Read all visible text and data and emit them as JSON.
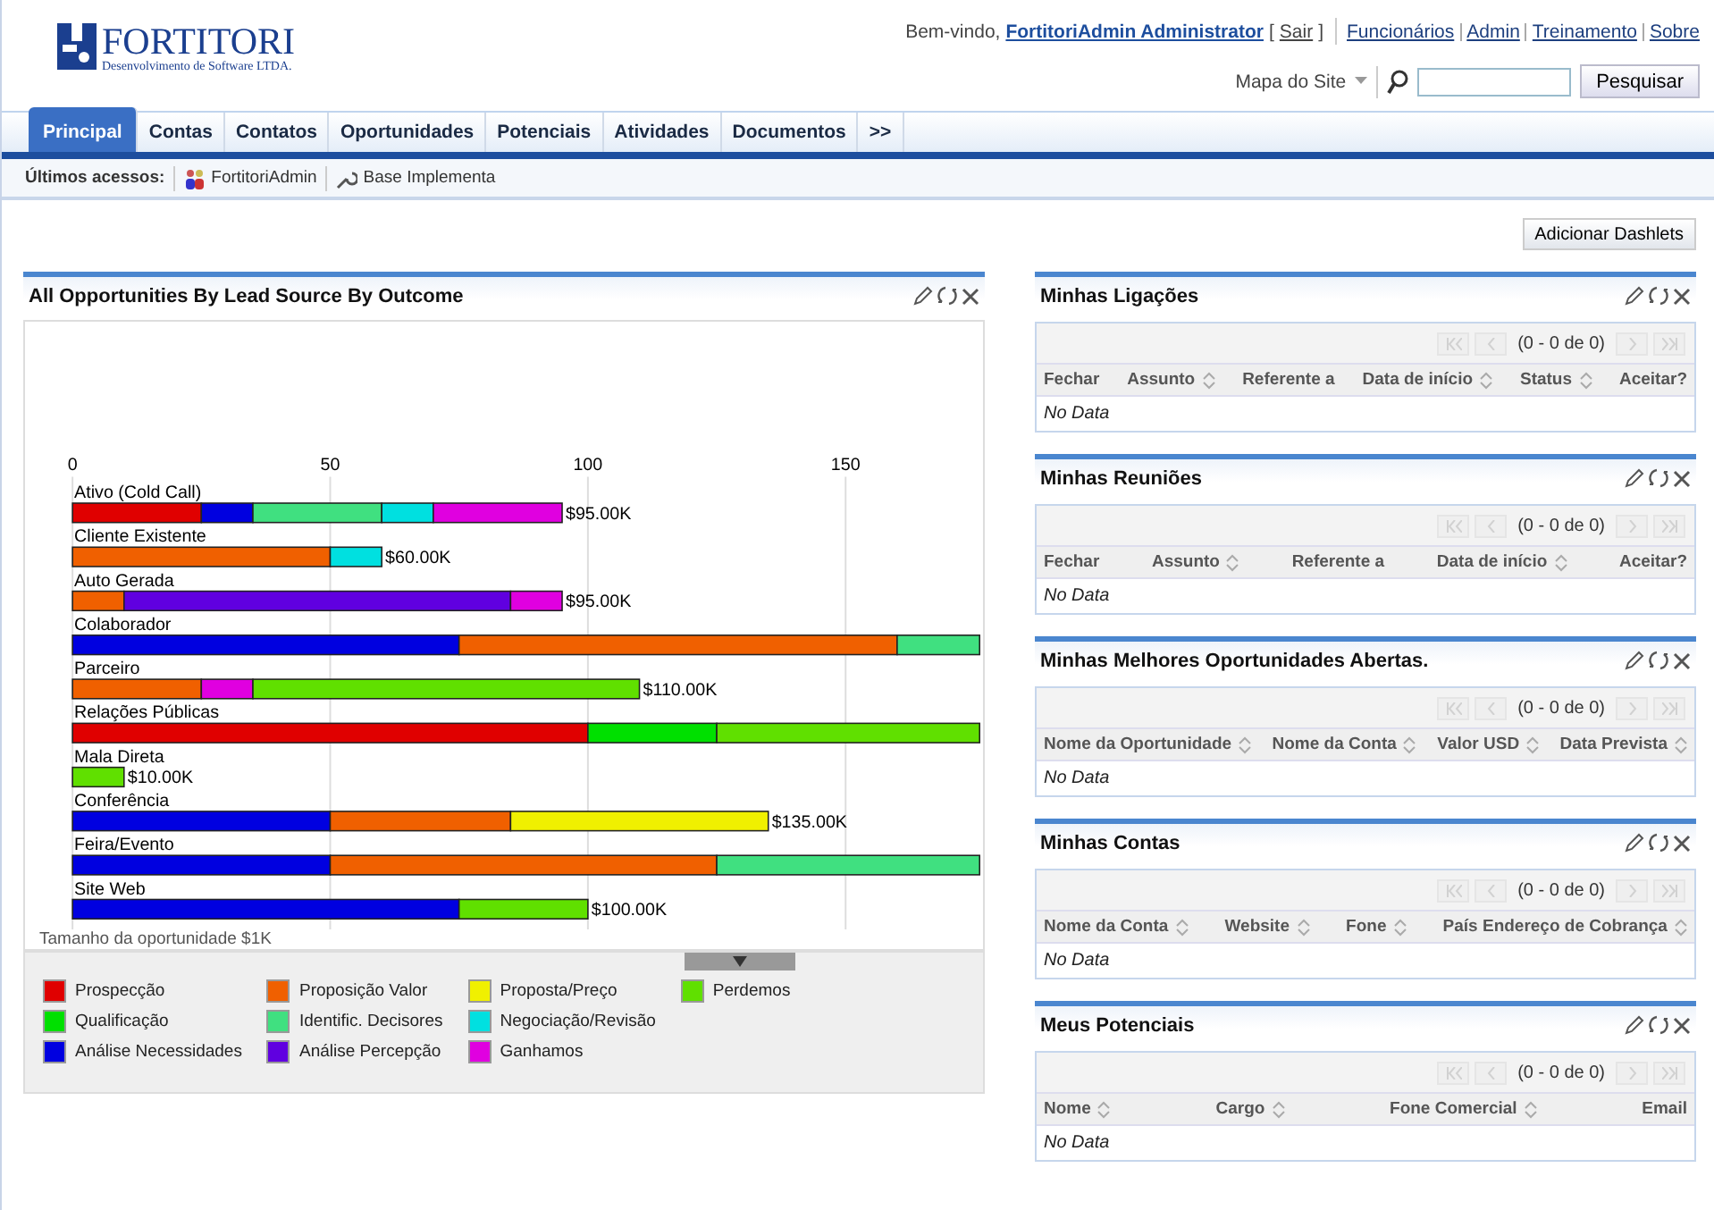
{
  "header": {
    "logo": {
      "name": "FORTITORI",
      "tagline": "Desenvolvimento de Software LTDA."
    },
    "welcome": {
      "greeting": "Bem-vindo,",
      "user": "FortitoriAdmin Administrator",
      "bracket_open": "[",
      "logout": "Sair",
      "bracket_close": "]"
    },
    "links": [
      "Funcionários",
      "Admin",
      "Treinamento",
      "Sobre"
    ],
    "sitemap": "Mapa do Site",
    "search_button": "Pesquisar"
  },
  "tabs": [
    {
      "label": "Principal",
      "selected": true
    },
    {
      "label": "Contas",
      "selected": false
    },
    {
      "label": "Contatos",
      "selected": false
    },
    {
      "label": "Oportunidades",
      "selected": false
    },
    {
      "label": "Potenciais",
      "selected": false
    },
    {
      "label": "Atividades",
      "selected": false
    },
    {
      "label": "Documentos",
      "selected": false
    },
    {
      "label": ">>",
      "selected": false
    }
  ],
  "recent": {
    "label": "Últimos acessos:",
    "items": [
      {
        "label": "FortitoriAdmin",
        "kind": "user"
      },
      {
        "label": "Base Implementa",
        "kind": "tool"
      }
    ]
  },
  "add_dashlets": "Adicionar Dashlets",
  "chart_panel": {
    "title": "All Opportunities By Lead Source By Outcome",
    "chart_data": {
      "type": "bar",
      "orientation": "horizontal",
      "stacked": true,
      "grid": true,
      "xlabel": "Tamanho da oportunidade $1K",
      "xlim": [
        0,
        176
      ],
      "xticks": [
        0,
        50,
        100,
        150
      ],
      "categories": [
        "Ativo (Cold Call)",
        "Cliente Existente",
        "Auto Gerada",
        "Colaborador",
        "Parceiro",
        "Relações Públicas",
        "Mala Direta",
        "Conferência",
        "Feira/Evento",
        "Site Web"
      ],
      "value_labels": [
        "$95.00K",
        "$60.00K",
        "$95.00K",
        null,
        "$110.00K",
        null,
        "$10.00K",
        "$135.00K",
        null,
        "$100.00K"
      ],
      "series": [
        {
          "name": "Prospecção",
          "color": "#e00000",
          "values": [
            25,
            0,
            0,
            0,
            0,
            100,
            0,
            0,
            0,
            0
          ]
        },
        {
          "name": "Qualificação",
          "color": "#00e000",
          "values": [
            0,
            0,
            0,
            0,
            0,
            25,
            0,
            0,
            0,
            0
          ]
        },
        {
          "name": "Análise Necessidades",
          "color": "#0000e0",
          "values": [
            10,
            0,
            0,
            75,
            0,
            0,
            0,
            50,
            50,
            75
          ]
        },
        {
          "name": "Proposição Valor",
          "color": "#f06000",
          "values": [
            0,
            50,
            10,
            85,
            25,
            0,
            0,
            35,
            75,
            0
          ]
        },
        {
          "name": "Identific. Decisores",
          "color": "#40e080",
          "values": [
            25,
            0,
            0,
            16,
            0,
            0,
            0,
            0,
            51,
            0
          ]
        },
        {
          "name": "Análise Percepção",
          "color": "#6000e0",
          "values": [
            0,
            0,
            75,
            0,
            0,
            0,
            0,
            0,
            0,
            0
          ]
        },
        {
          "name": "Proposta/Preço",
          "color": "#f0f000",
          "values": [
            0,
            0,
            0,
            0,
            0,
            0,
            0,
            50,
            0,
            0
          ]
        },
        {
          "name": "Negociação/Revisão",
          "color": "#00e0e0",
          "values": [
            10,
            10,
            0,
            0,
            0,
            0,
            0,
            0,
            0,
            0
          ]
        },
        {
          "name": "Ganhamos",
          "color": "#e000e0",
          "values": [
            25,
            0,
            10,
            0,
            10,
            0,
            0,
            0,
            0,
            0
          ]
        },
        {
          "name": "Perdemos",
          "color": "#60e000",
          "values": [
            0,
            0,
            0,
            0,
            75,
            51,
            10,
            0,
            0,
            25
          ]
        }
      ]
    }
  },
  "dashlets": [
    {
      "title": "Minhas Ligações",
      "pager": "(0 - 0 de 0)",
      "pager_disabled": true,
      "columns": [
        {
          "label": "Fechar",
          "sortable": false
        },
        {
          "label": "Assunto",
          "sortable": true
        },
        {
          "label": "Referente a",
          "sortable": false
        },
        {
          "label": "Data de início",
          "sortable": true
        },
        {
          "label": "Status",
          "sortable": true
        },
        {
          "label": "Aceitar?",
          "sortable": false
        }
      ],
      "empty_text": "No Data"
    },
    {
      "title": "Minhas Reuniões",
      "pager": "(0 - 0 de 0)",
      "pager_disabled": true,
      "columns": [
        {
          "label": "Fechar",
          "sortable": false
        },
        {
          "label": "Assunto",
          "sortable": true
        },
        {
          "label": "Referente a",
          "sortable": false
        },
        {
          "label": "Data de início",
          "sortable": true
        },
        {
          "label": "Aceitar?",
          "sortable": false
        }
      ],
      "empty_text": "No Data"
    },
    {
      "title": "Minhas Melhores Oportunidades Abertas.",
      "pager": "(0 - 0 de 0)",
      "pager_disabled": true,
      "columns": [
        {
          "label": "Nome da Oportunidade",
          "sortable": true
        },
        {
          "label": "Nome da Conta",
          "sortable": true
        },
        {
          "label": "Valor USD",
          "sortable": true
        },
        {
          "label": "Data Prevista",
          "sortable": true
        }
      ],
      "empty_text": "No Data"
    },
    {
      "title": "Minhas Contas",
      "pager": "(0 - 0 de 0)",
      "pager_disabled": true,
      "columns": [
        {
          "label": "Nome da Conta",
          "sortable": true
        },
        {
          "label": "Website",
          "sortable": true
        },
        {
          "label": "Fone",
          "sortable": true
        },
        {
          "label": "País Endereço de Cobrança",
          "sortable": true
        }
      ],
      "empty_text": "No Data"
    },
    {
      "title": "Meus Potenciais",
      "pager": "(0 - 0 de 0)",
      "pager_disabled": true,
      "columns": [
        {
          "label": "Nome",
          "sortable": true
        },
        {
          "label": "Cargo",
          "sortable": true
        },
        {
          "label": "Fone Comercial",
          "sortable": true
        },
        {
          "label": "Email",
          "sortable": false
        }
      ],
      "empty_text": "No Data"
    }
  ]
}
